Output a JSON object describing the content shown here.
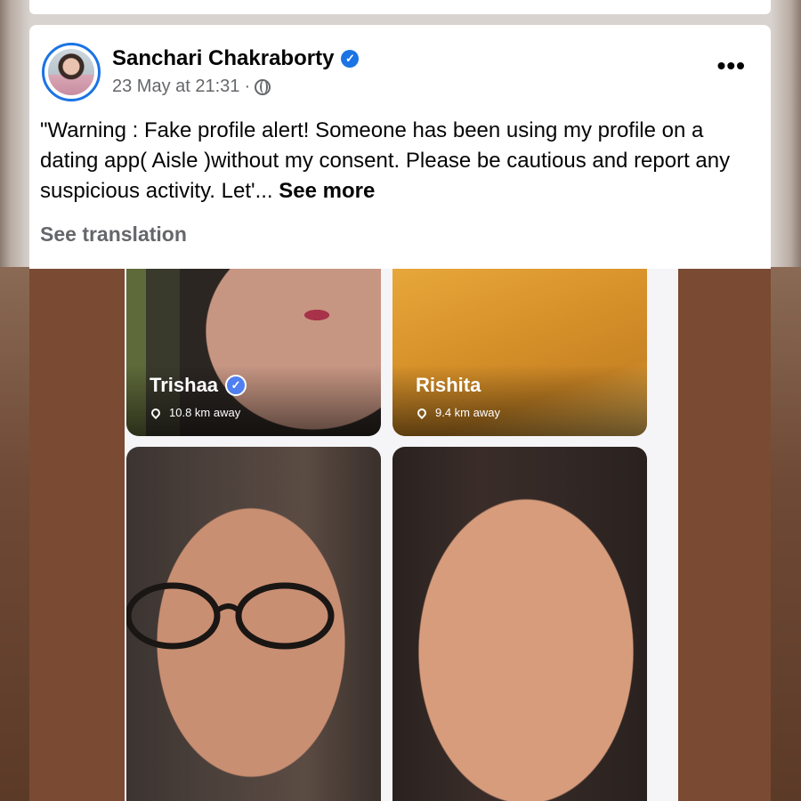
{
  "post": {
    "author": "Sanchari Chakraborty",
    "verified_mark": "✓",
    "timestamp": "23 May at 21:31",
    "separator": "·",
    "audience_icon": "globe-icon",
    "more_label": "•••",
    "text": "\"Warning : Fake profile alert! Someone has been using my profile on a dating app( Aisle )without my consent. Please be cautious and report any suspicious activity. Let'... ",
    "see_more": "See more",
    "see_translation": "See translation"
  },
  "profiles": [
    {
      "name": "Trishaa",
      "verified": "✓",
      "distance": "10.8 km away"
    },
    {
      "name": "Rishita",
      "distance": "9.4 km away"
    }
  ],
  "colors": {
    "accent": "#1b74e4",
    "text": "#050505",
    "muted": "#65676b",
    "photo_background": "#7a4a33"
  }
}
